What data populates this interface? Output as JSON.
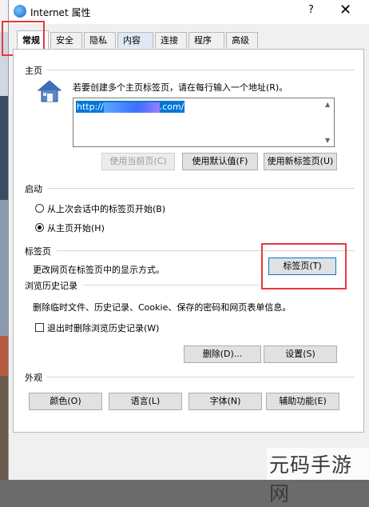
{
  "window": {
    "title": "Internet 属性",
    "help": "?",
    "close": "✕"
  },
  "tabs": [
    {
      "label": "常规"
    },
    {
      "label": "安全"
    },
    {
      "label": "隐私"
    },
    {
      "label": "内容"
    },
    {
      "label": "连接"
    },
    {
      "label": "程序"
    },
    {
      "label": "高级"
    }
  ],
  "homepage": {
    "section": "主页",
    "description": "若要创建多个主页标签页，请在每行输入一个地址(R)。",
    "url_prefix": "http://",
    "url_suffix": ".com/",
    "buttons": {
      "use_current": "使用当前页(C)",
      "use_default": "使用默认值(F)",
      "use_new_tab": "使用新标签页(U)"
    }
  },
  "startup": {
    "section": "启动",
    "option_last_session": "从上次会话中的标签页开始(B)",
    "option_homepage": "从主页开始(H)"
  },
  "tabs_section": {
    "section": "标签页",
    "description": "更改网页在标签页中的显示方式。",
    "button": "标签页(T)"
  },
  "history": {
    "section": "浏览历史记录",
    "description": "删除临时文件、历史记录、Cookie、保存的密码和网页表单信息。",
    "checkbox": "退出时删除浏览历史记录(W)",
    "delete_button": "删除(D)...",
    "settings_button": "设置(S)"
  },
  "appearance": {
    "section": "外观",
    "colors": "颜色(O)",
    "languages": "语言(L)",
    "fonts": "字体(N)",
    "accessibility": "辅助功能(E)"
  },
  "watermark": "元码手游网",
  "colors": {
    "highlight": "#e8383d",
    "selection": "#0078d7"
  }
}
